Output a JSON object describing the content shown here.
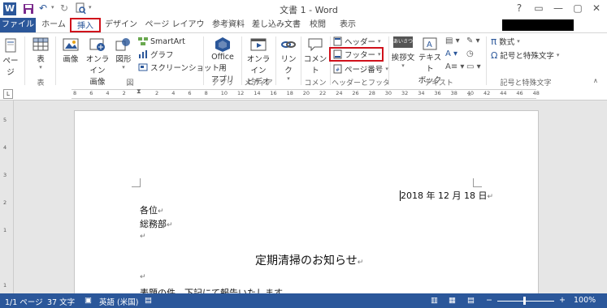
{
  "window": {
    "title": "文書 1 - Word",
    "controls": [
      "?",
      "▭",
      "—",
      "▢",
      "✕"
    ]
  },
  "tabs": [
    {
      "label": "ファイル"
    },
    {
      "label": "ホーム"
    },
    {
      "label": "挿入"
    },
    {
      "label": "デザイン"
    },
    {
      "label": "ページ レイアウト"
    },
    {
      "label": "参考資料"
    },
    {
      "label": "差し込み文書"
    },
    {
      "label": "校閲"
    },
    {
      "label": "表示"
    }
  ],
  "ribbon": {
    "pages": {
      "label": "ページ"
    },
    "table": {
      "label": "表",
      "group": "表"
    },
    "image": {
      "label": "画像"
    },
    "online_image": {
      "label1": "オンライン",
      "label2": "画像"
    },
    "shapes": {
      "label": "図形"
    },
    "smartart": {
      "label": "SmartArt"
    },
    "graph": {
      "label": "グラフ"
    },
    "screenshot": {
      "label": "スクリーンショット"
    },
    "figure_group": "図",
    "office_app": {
      "label1": "Office 用",
      "label2": "アプリ"
    },
    "apps_group": "アプリ",
    "online_video": {
      "label1": "オンライン",
      "label2": "ビデオ"
    },
    "media_group": "メディア",
    "link": {
      "label": "リンク"
    },
    "comment": {
      "label": "コメント"
    },
    "comment_group": "コメント",
    "header": {
      "label": "ヘッダー"
    },
    "footer": {
      "label": "フッター"
    },
    "page_number": {
      "label": "ページ番号"
    },
    "hf_group": "ヘッダーとフッター",
    "greeting": {
      "label": "挨拶文",
      "icon_text": "あいさつ"
    },
    "textbox": {
      "label1": "テキスト",
      "label2": "ボックス"
    },
    "text_group": "テキスト",
    "equation": {
      "label": "数式",
      "icon": "π"
    },
    "symbol": {
      "label": "記号と特殊文字",
      "icon": "Ω"
    },
    "symbol_group": "記号と特殊文字"
  },
  "ruler": {
    "ticks": [
      "8",
      "6",
      "4",
      "2",
      "",
      "2",
      "4",
      "6",
      "8",
      "10",
      "12",
      "14",
      "16",
      "18",
      "20",
      "22",
      "24",
      "26",
      "28",
      "30",
      "32",
      "34",
      "36",
      "38",
      "40",
      "42",
      "44",
      "46",
      "48"
    ],
    "vticks": [
      "5",
      "4",
      "3",
      "2",
      "1",
      "",
      "1"
    ]
  },
  "document": {
    "date": "2018 年 12 月 18 日",
    "to": "各位",
    "from": "総務部",
    "title": "定期清掃のお知らせ",
    "body_partial": "表題の件、下記にて報告いたします。"
  },
  "status": {
    "page": "1/1 ページ",
    "words": "37 文字",
    "lang": "英語 (米国)",
    "zoom": "100%"
  },
  "colors": {
    "accent": "#2b579a",
    "highlight": "#d0111b"
  }
}
